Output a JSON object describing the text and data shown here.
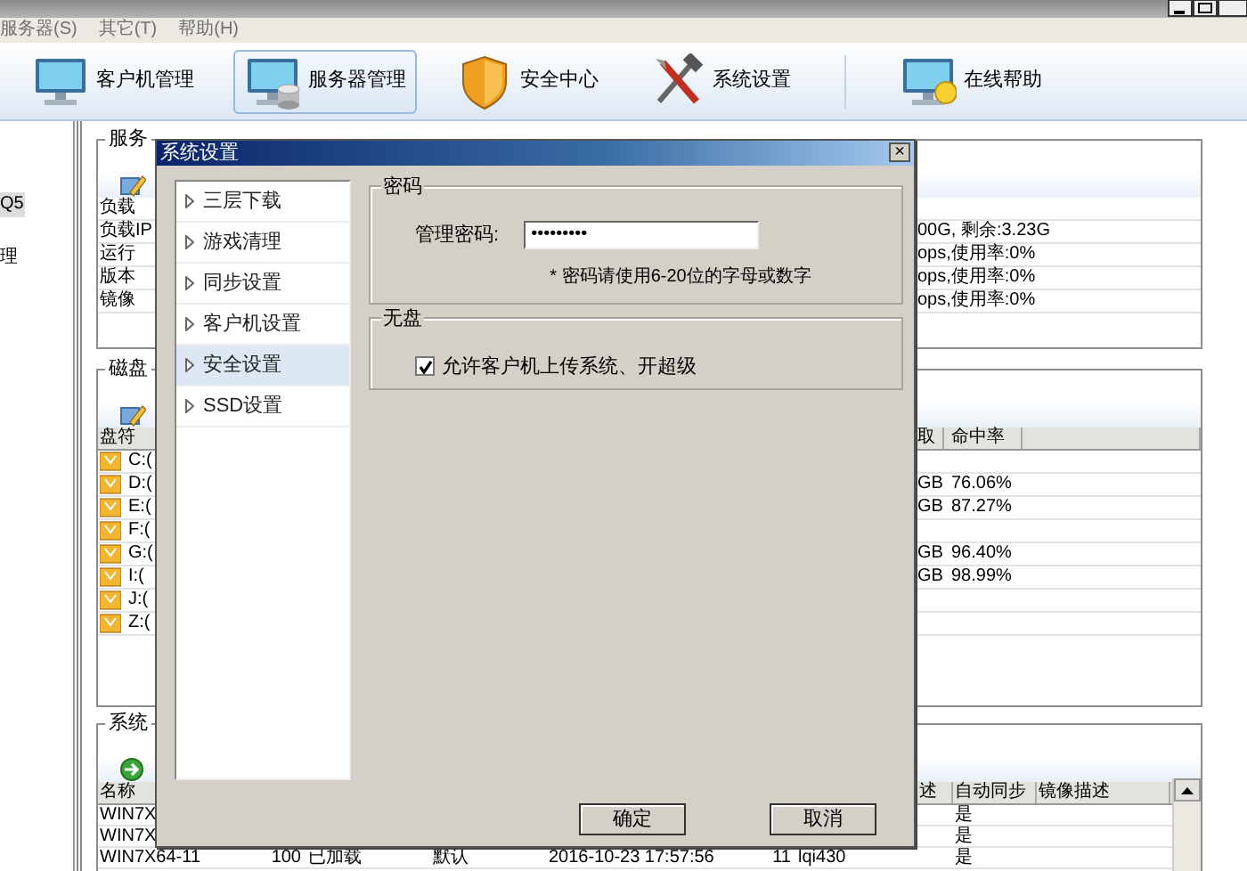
{
  "menu": [
    "服务器(S)",
    "其它(T)",
    "帮助(H)"
  ],
  "toolbar": [
    {
      "label": "客户机管理",
      "selected": false
    },
    {
      "label": "服务器管理",
      "selected": true
    },
    {
      "label": "安全中心",
      "selected": false
    },
    {
      "label": "系统设置",
      "selected": false
    },
    {
      "label": "在线帮助",
      "selected": false
    }
  ],
  "sidebar": {
    "items": [
      {
        "label": "Q5",
        "selected": true
      },
      {
        "label": "理",
        "selected": false
      }
    ]
  },
  "server_panel": {
    "title": "服务",
    "rows": [
      {
        "label": "负载"
      },
      {
        "label": "负载IP",
        "value": "00G, 剩余:3.23G"
      },
      {
        "label": "运行",
        "value": "ops,使用率:0%"
      },
      {
        "label": "版本",
        "value": "ops,使用率:0%"
      },
      {
        "label": "镜像",
        "value": "ops,使用率:0%"
      }
    ]
  },
  "disk_panel": {
    "title": "磁盘",
    "columns": [
      "盘符",
      "取",
      "命中率"
    ],
    "rows": [
      {
        "drive": "C:("
      },
      {
        "drive": "D:(",
        "read": "GB",
        "hit_rate": "76.06%"
      },
      {
        "drive": "E:(",
        "read": "GB",
        "hit_rate": "87.27%"
      },
      {
        "drive": "F:("
      },
      {
        "drive": "G:(",
        "read": "GB",
        "hit_rate": "96.40%"
      },
      {
        "drive": "I:(",
        "read": "GB",
        "hit_rate": "98.99%"
      },
      {
        "drive": "J:("
      },
      {
        "drive": "Z:("
      }
    ]
  },
  "system_panel": {
    "title": "系统",
    "columns": {
      "name": "名称",
      "desc": "述",
      "auto_sync": "自动同步",
      "image_desc": "镜像描述"
    },
    "rows": [
      {
        "cells": [
          "WIN7X"
        ],
        "auto_sync": "是"
      },
      {
        "cells": [
          "WIN7X"
        ],
        "auto_sync": "是"
      },
      {
        "cells": [
          "WIN7X64-11",
          "100",
          "已加载",
          "默认",
          "2016-10-23 17:57:56",
          "11",
          "lqi430"
        ],
        "auto_sync": "是"
      }
    ]
  },
  "dialog": {
    "title": "系统设置",
    "close": "×",
    "nav": [
      {
        "label": "三层下载",
        "selected": false
      },
      {
        "label": "游戏清理",
        "selected": false
      },
      {
        "label": "同步设置",
        "selected": false
      },
      {
        "label": "客户机设置",
        "selected": false
      },
      {
        "label": "安全设置",
        "selected": true
      },
      {
        "label": "SSD设置",
        "selected": false
      }
    ],
    "password_group": {
      "title": "密码",
      "label": "管理密码:",
      "value": "•••••••••",
      "note": "* 密码请使用6-20位的字母或数字"
    },
    "diskless_group": {
      "title": "无盘",
      "checkbox": {
        "label": "允许客户机上传系统、开超级",
        "checked": true
      }
    },
    "buttons": [
      "确定",
      "取消"
    ]
  }
}
